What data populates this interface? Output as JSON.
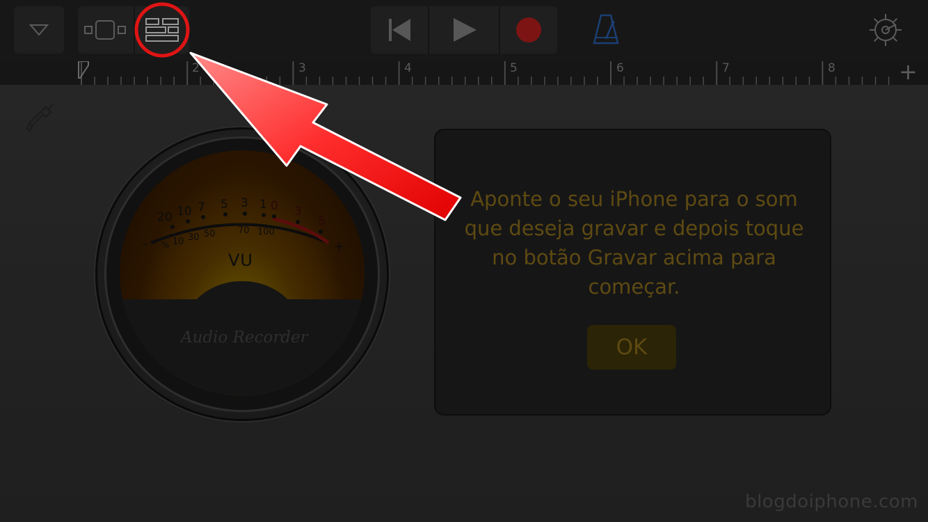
{
  "toolbar": {
    "menu_icon": "chevron-down-icon",
    "tracks_view_icon": "tracks-view-icon",
    "instrument_view_icon": "instrument-view-icon",
    "rewind_icon": "go-to-beginning-icon",
    "play_icon": "play-icon",
    "record_icon": "record-icon",
    "metronome_icon": "metronome-icon",
    "settings_icon": "gear-icon",
    "colors": {
      "record": "#8e1a1a",
      "metronome": "#1a4a8e"
    }
  },
  "ruler": {
    "bar_numbers": [
      "2",
      "3",
      "4",
      "5",
      "6",
      "7",
      "8"
    ],
    "add_label": "+"
  },
  "input_jack_icon": "audio-jack-icon",
  "vu_meter": {
    "top_scale": [
      "20",
      "10",
      "7",
      "5",
      "3",
      "1",
      "0",
      "3",
      "5"
    ],
    "percent_scale": [
      "%",
      "10",
      "30",
      "50",
      "70",
      "100"
    ],
    "minus": "–",
    "plus": "+",
    "label": "VU",
    "brand": "Audio Recorder"
  },
  "dialog": {
    "message": "Aponte o seu iPhone para o som que deseja gravar e depois toque no botão Gravar acima para começar.",
    "ok_label": "OK"
  },
  "annotation": {
    "highlight_color": "#e41a1a"
  },
  "watermark": "blogdoiphone.com"
}
